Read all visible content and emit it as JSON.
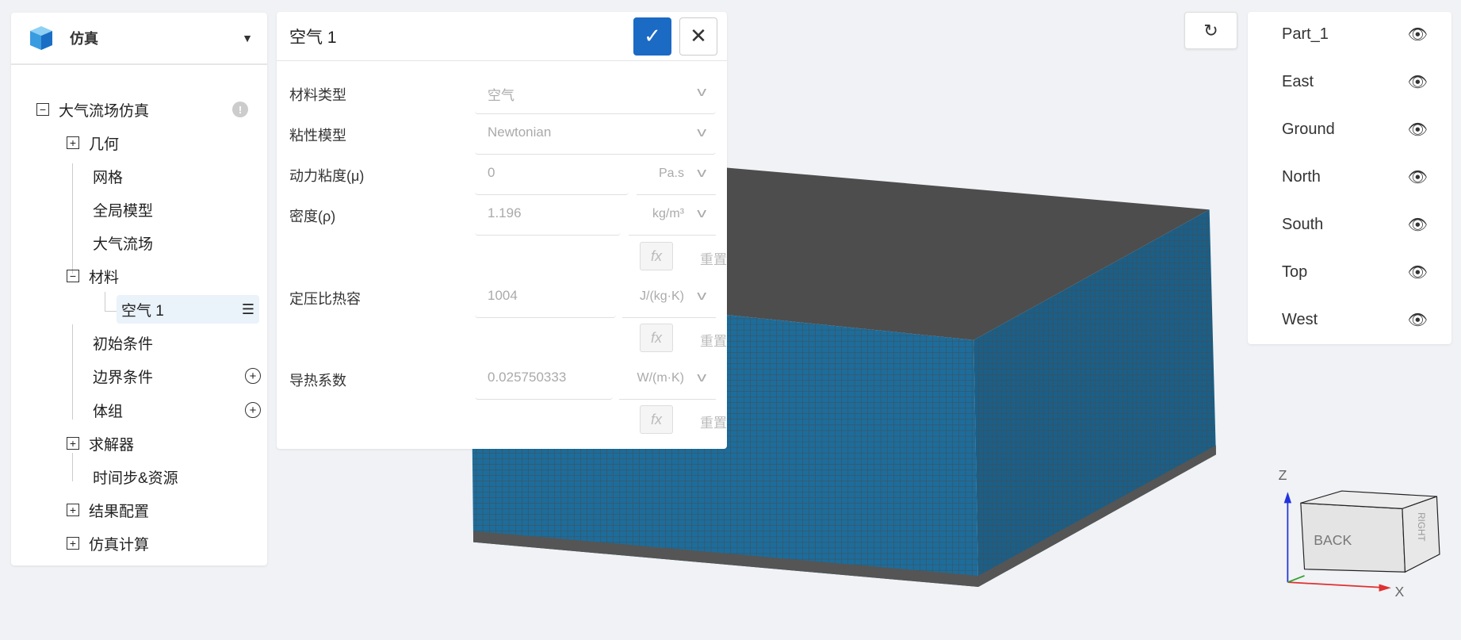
{
  "sidebar": {
    "title": "仿真",
    "tree": {
      "root": "大气流场仿真",
      "geometry": "几何",
      "mesh": "网格",
      "global_model": "全局模型",
      "atmos_flow": "大气流场",
      "material": "材料",
      "air1": "空气 1",
      "initial": "初始条件",
      "boundary": "边界条件",
      "body_group": "体组",
      "solver": "求解器",
      "timestep": "时间步&资源",
      "result_cfg": "结果配置",
      "sim_calc": "仿真计算"
    }
  },
  "form": {
    "title": "空气 1",
    "fields": [
      {
        "label": "材料类型",
        "value": "空气"
      },
      {
        "label": "粘性模型",
        "value": "Newtonian"
      },
      {
        "label": "动力粘度(μ)",
        "value": "0",
        "unit": "Pa.s"
      },
      {
        "label": "密度(ρ)",
        "value": "1.196",
        "unit": "kg/m³"
      },
      {
        "label": "定压比热容",
        "value": "1004",
        "unit": "J/(kg·K)"
      },
      {
        "label": "导热系数",
        "value": "0.025750333",
        "unit": "W/(m·K)"
      }
    ],
    "fx": "fx",
    "reset": "重置"
  },
  "visibility": {
    "items": [
      "Part_1",
      "East",
      "Ground",
      "North",
      "South",
      "Top",
      "West"
    ]
  },
  "gizmo": {
    "z": "Z",
    "x": "X",
    "face": "BACK",
    "right": "RIGHT"
  },
  "colors": {
    "accent": "#1b6ac4",
    "mesh": "#1c6d9c"
  }
}
